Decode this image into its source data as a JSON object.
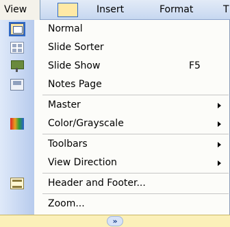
{
  "menubar": {
    "view": "View",
    "insert": "Insert",
    "format": "Format",
    "more": "T"
  },
  "menu": {
    "items": [
      {
        "label": "Normal",
        "icon": "normal-view-icon"
      },
      {
        "label": "Slide Sorter",
        "icon": "slide-sorter-icon"
      },
      {
        "label": "Slide Show",
        "shortcut": "F5",
        "icon": "slide-show-icon"
      },
      {
        "label": "Notes Page",
        "icon": "notes-page-icon"
      },
      {
        "label": "Master",
        "submenu": true
      },
      {
        "label": "Color/Grayscale",
        "submenu": true,
        "icon": "color-grayscale-icon"
      },
      {
        "label": "Toolbars",
        "submenu": true
      },
      {
        "label": "View Direction",
        "submenu": true
      },
      {
        "label": "Header and Footer...",
        "icon": "header-footer-icon"
      },
      {
        "label": "Zoom..."
      }
    ],
    "expand": "»"
  },
  "colors": {
    "highlight": "#316ac5",
    "menubar": "#c6d7f0",
    "expand_bar": "#fbf0b9"
  }
}
